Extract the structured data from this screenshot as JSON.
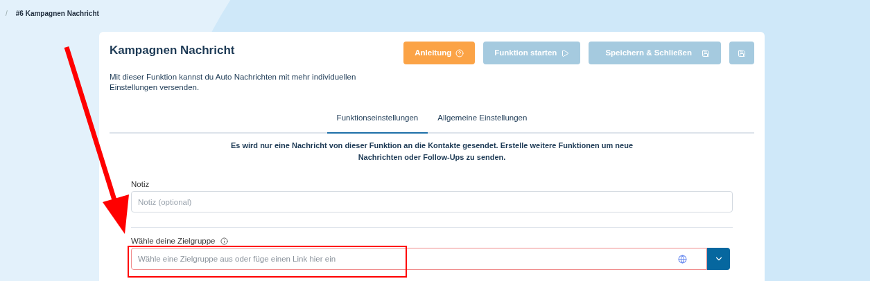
{
  "breadcrumb": {
    "separator": "/",
    "current": "#6 Kampagnen Nachricht"
  },
  "card": {
    "title": "Kampagnen Nachricht",
    "description": "Mit dieser Funktion kannst du Auto Nachrichten mit mehr individuellen Einstellungen versenden.",
    "buttons": [
      {
        "label": "Anleitung",
        "kind": "help",
        "disabled": false
      },
      {
        "label": "Funktion starten",
        "kind": "start",
        "disabled": true
      },
      {
        "label": "Speichern & Schließen",
        "kind": "save_close",
        "disabled": true
      },
      {
        "kind": "save",
        "disabled": true
      }
    ],
    "tabs": [
      {
        "label": "Funktionseinstellungen",
        "selected": true
      },
      {
        "label": "Allgemeine Einstellungen",
        "selected": false
      }
    ],
    "notice": "Es wird nur eine Nachricht von dieser Funktion an die Kontakte gesendet. Erstelle weitere Funktionen um neue Nachrichten oder Follow-Ups zu senden.",
    "note_field": {
      "label": "Notiz",
      "placeholder": "Notiz (optional)"
    },
    "target_field": {
      "label": "Wähle deine Zielgruppe",
      "placeholder": "Wähle eine Zielgruppe aus oder füge einen Link hier ein",
      "invalid": true
    }
  },
  "annotation": {
    "arrow": true,
    "highlight": true
  }
}
